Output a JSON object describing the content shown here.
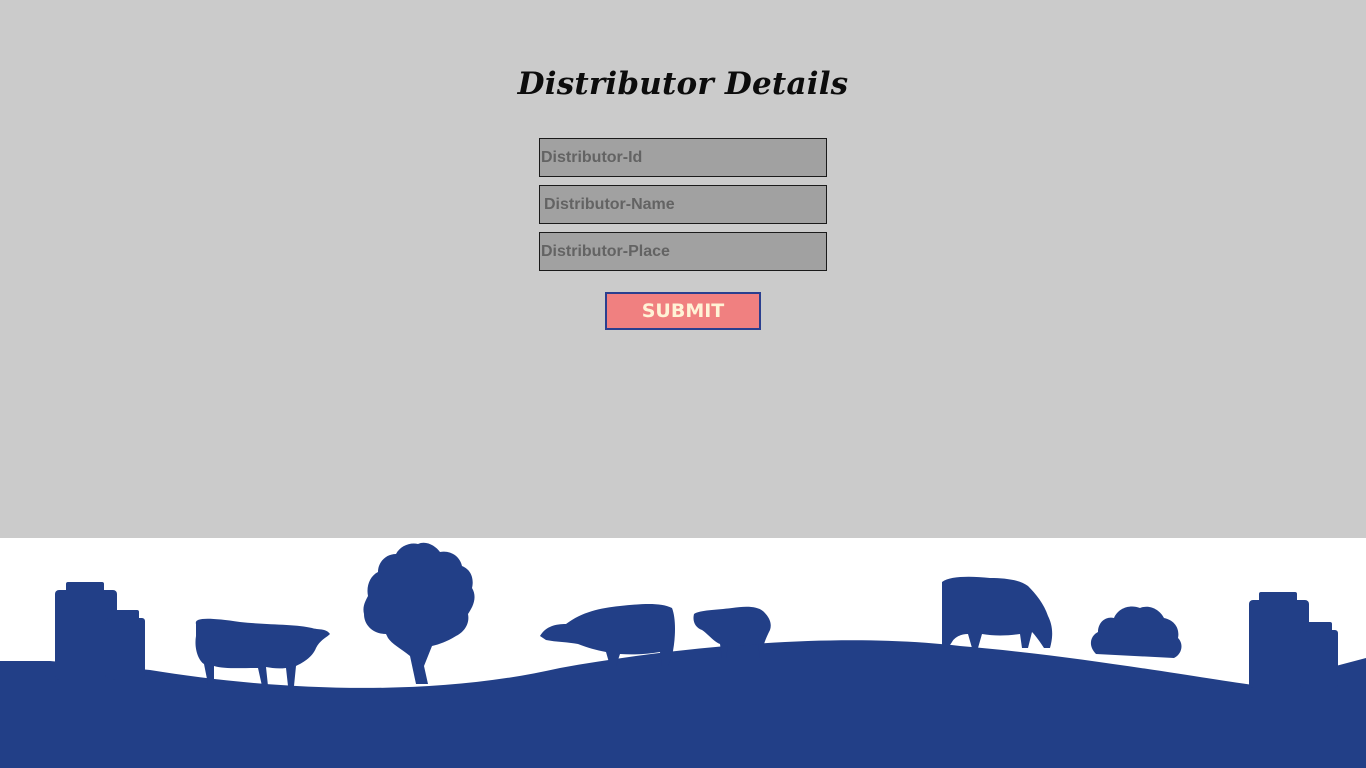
{
  "form": {
    "title": "Distributor Details",
    "fields": [
      {
        "name": "distributor-id",
        "placeholder": "Distributor-Id",
        "value": ""
      },
      {
        "name": "distributor-name",
        "placeholder": "Distributor-Name",
        "value": ""
      },
      {
        "name": "distributor-place",
        "placeholder": "Distributor-Place",
        "value": ""
      }
    ],
    "submit_label": "SUBMIT"
  },
  "footer_illustration": {
    "icon": "farm-landscape-illustration",
    "color": "#223f87"
  },
  "colors": {
    "page_background": "#cbcbcb",
    "field_background": "#a1a1a1",
    "button_background": "#f08080",
    "button_border": "#2a3f8f",
    "button_text": "#fff3d6"
  }
}
